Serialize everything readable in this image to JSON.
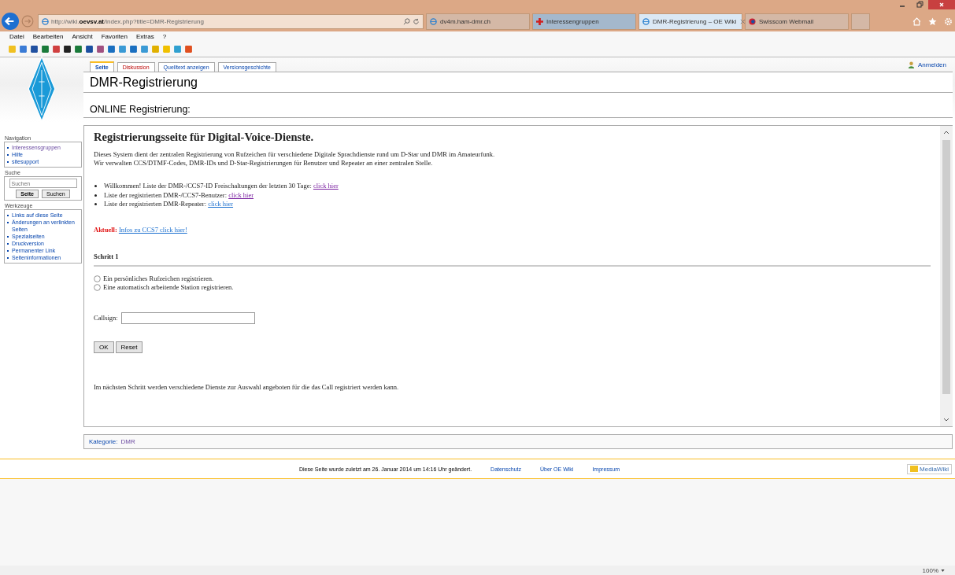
{
  "browser": {
    "address": "http://wiki.**oevsv.at**/index.php?title=DMR-Registrierung",
    "tabs": [
      {
        "label": "dv4m.ham-dmr.ch",
        "selected": false,
        "kind": "ie"
      },
      {
        "label": "Interessengruppen",
        "selected": false,
        "kind": "cross"
      },
      {
        "label": "DMR-Registrierung – OE Wiki",
        "selected": true,
        "kind": "ie"
      },
      {
        "label": "Swisscom Webmail",
        "selected": false,
        "kind": "swisscom"
      }
    ],
    "menu": [
      "Datei",
      "Bearbeiten",
      "Ansicht",
      "Favoriten",
      "Extras",
      "?"
    ],
    "zoom": "100%"
  },
  "wiki": {
    "page_tabs": [
      {
        "label": "Seite",
        "selected": true,
        "missing": false
      },
      {
        "label": "Diskussion",
        "selected": false,
        "missing": true
      },
      {
        "label": "Quelltext anzeigen",
        "selected": false,
        "missing": false
      },
      {
        "label": "Versionsgeschichte",
        "selected": false,
        "missing": false
      }
    ],
    "login": "Anmelden",
    "title": "DMR-Registrierung",
    "subtitle": "ONLINE Registrierung:",
    "sidebar": {
      "navigation": {
        "heading": "Navigation",
        "items": [
          {
            "label": "Interessensgruppen",
            "visited": true
          },
          {
            "label": "Hilfe",
            "visited": false
          },
          {
            "label": "sitesupport",
            "visited": false
          }
        ]
      },
      "search": {
        "heading": "Suche",
        "placeholder": "Suchen",
        "buttons": [
          "Seite",
          "Suchen"
        ]
      },
      "tools": {
        "heading": "Werkzeuge",
        "items": [
          {
            "label": "Links auf diese Seite",
            "visited": false
          },
          {
            "label": "Änderungen an verlinkten Seiten",
            "visited": false
          },
          {
            "label": "Spezialseiten",
            "visited": false
          },
          {
            "label": "Druckversion",
            "visited": false
          },
          {
            "label": "Permanenter Link",
            "visited": false
          },
          {
            "label": "Seiteninformationen",
            "visited": false
          }
        ]
      }
    },
    "frame": {
      "heading": "Registrierungsseite für Digital-Voice-Dienste.",
      "intro": [
        "Dieses System dient der zentralen Registrierung von Rufzeichen für verschiedene Digitale Sprachdienste rund um D-Star und DMR im Amateurfunk.",
        "Wir verwalten CCS/DTMF-Codes, DMR-IDs und D-Star-Registrierungen für Benutzer und Repeater an einer zentralen Stelle."
      ],
      "bullets": [
        {
          "text": "Willkommen! Liste der DMR-/CCS7-ID Freischaltungen der letzten 30 Tage:",
          "link": "click hier",
          "visited": true
        },
        {
          "text": "Liste der registrierten DMR-/CCS7-Benutzer:",
          "link": "click hier",
          "visited": true
        },
        {
          "text": "Liste der registrierten DMR-Repeater:",
          "link": "click hier",
          "visited": false
        }
      ],
      "notice": {
        "label": "Aktuell:",
        "link": "Infos zu CCS7 click hier!"
      },
      "step": "Schritt 1",
      "options": [
        {
          "label": "Ein persönliches Rufzeichen registrieren.",
          "selected": false
        },
        {
          "label": "Eine automatisch arbeitende Station registrieren.",
          "selected": false
        }
      ],
      "callsign_label": "Callsign:",
      "buttons": [
        "OK",
        "Reset"
      ],
      "note": "Im nächsten Schritt werden verschiedene Dienste zur Auswahl angeboten für die das Call registriert werden kann."
    },
    "category": {
      "label": "Kategorie:",
      "value": "DMR"
    },
    "footer": {
      "text": "Diese Seite wurde zuletzt am 26. Januar 2014 um 14:16 Uhr geändert.",
      "links": [
        "Datenschutz",
        "Über OE Wiki",
        "Impressum"
      ],
      "badge": "MediaWiki"
    }
  }
}
